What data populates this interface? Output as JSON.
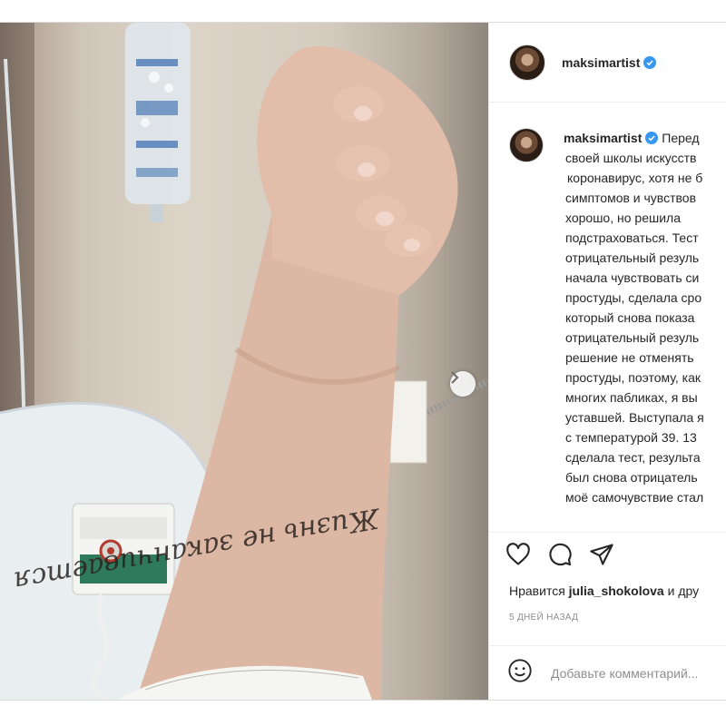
{
  "post": {
    "username": "maksimartist",
    "verified_icon": "verified-badge-icon",
    "caption_lines": [
      "Перед",
      "своей школы искусств",
      "коронавирус, хотя не б",
      "симптомов и чувствов",
      "хорошо, но решила",
      "подстраховаться. Тест",
      "отрицательный резуль",
      "начала чувствовать си",
      "простуды, сделала сро",
      "который снова показа",
      "отрицательный резуль",
      "решение не отменять",
      "простуды, поэтому, как",
      "многих пабликах, я вы",
      "уставшей. Выступала я",
      "с температурой 39. 13",
      "сделала тест, результа",
      "был снова отрицатель",
      "моё самочувствие стал"
    ],
    "likes_prefix": "Нравится",
    "likes_user": "julia_shokolova",
    "likes_suffix": "и дру",
    "timestamp": "5 дней назад",
    "comment_placeholder": "Добавьте комментарий...",
    "tattoo_text": "Жизнь не заканчивается"
  },
  "colors": {
    "verified": "#3897f0",
    "text": "#262626",
    "muted": "#8e8e8e",
    "border": "#efefef"
  },
  "icons": [
    "heart-icon",
    "comment-icon",
    "share-icon",
    "emoji-icon",
    "chevron-right-icon"
  ]
}
